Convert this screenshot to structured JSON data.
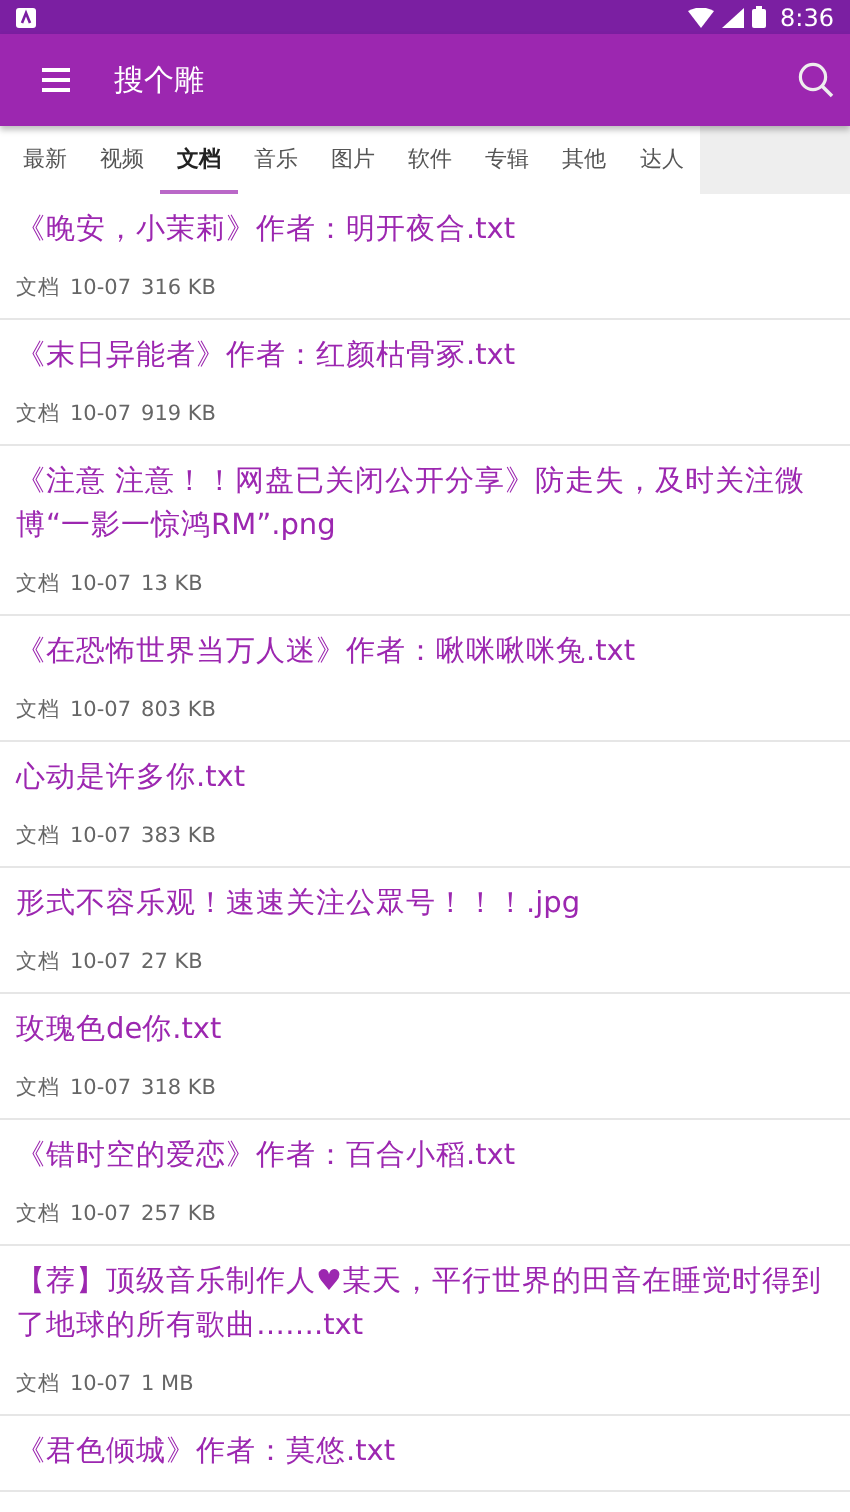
{
  "status_bar": {
    "time": "8:36"
  },
  "app_bar": {
    "title": "搜个雕"
  },
  "tabs": [
    {
      "label": "最新",
      "selected": false
    },
    {
      "label": "视频",
      "selected": false
    },
    {
      "label": "文档",
      "selected": true
    },
    {
      "label": "音乐",
      "selected": false
    },
    {
      "label": "图片",
      "selected": false
    },
    {
      "label": "软件",
      "selected": false
    },
    {
      "label": "专辑",
      "selected": false
    },
    {
      "label": "其他",
      "selected": false
    },
    {
      "label": "达人",
      "selected": false
    }
  ],
  "files": [
    {
      "name": "《晚安，小茉莉》作者：明开夜合.txt",
      "type": "文档",
      "date": "10-07",
      "size": "316 KB"
    },
    {
      "name": "《末日异能者》作者：红颜枯骨冢.txt",
      "type": "文档",
      "date": "10-07",
      "size": "919 KB"
    },
    {
      "name": "《注意 注意！！网盘已关闭公开分享》防走失，及时关注微博“一影一惊鸿RM”.png",
      "type": "文档",
      "date": "10-07",
      "size": "13 KB"
    },
    {
      "name": "《在恐怖世界当万人迷》作者：啾咪啾咪兔.txt",
      "type": "文档",
      "date": "10-07",
      "size": "803 KB"
    },
    {
      "name": "心动是许多你.txt",
      "type": "文档",
      "date": "10-07",
      "size": "383 KB"
    },
    {
      "name": "形式不容乐观！速速关注公眾号！！！.jpg",
      "type": "文档",
      "date": "10-07",
      "size": "27 KB"
    },
    {
      "name": "玫瑰色de你.txt",
      "type": "文档",
      "date": "10-07",
      "size": "318 KB"
    },
    {
      "name": "《错时空的爱恋》作者：百合小稻.txt",
      "type": "文档",
      "date": "10-07",
      "size": "257 KB"
    },
    {
      "name": "【荐】顶级音乐制作人♥某天，平行世界的田音在睡觉时得到了地球的所有歌曲…….txt",
      "type": "文档",
      "date": "10-07",
      "size": "1 MB"
    },
    {
      "name": "《君色倾城》作者：莫悠.txt"
    }
  ]
}
